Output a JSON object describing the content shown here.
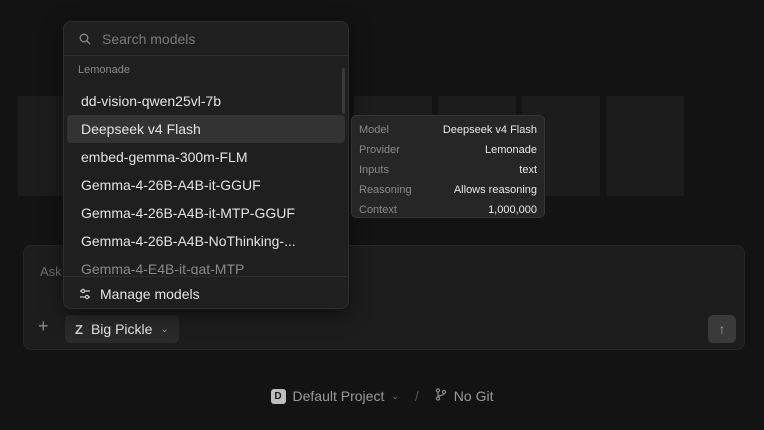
{
  "dropdown": {
    "search_placeholder": "Search models",
    "group_label": "Lemonade",
    "items": [
      {
        "label": "dd-vision-qwen25vl-7b"
      },
      {
        "label": "Deepseek v4 Flash"
      },
      {
        "label": "embed-gemma-300m-FLM"
      },
      {
        "label": "Gemma-4-26B-A4B-it-GGUF"
      },
      {
        "label": "Gemma-4-26B-A4B-it-MTP-GGUF"
      },
      {
        "label": "Gemma-4-26B-A4B-NoThinking-..."
      },
      {
        "label": "Gemma-4-E4B-it-qat-MTP"
      }
    ],
    "active_index": 1,
    "manage_label": "Manage models"
  },
  "tooltip": {
    "rows": [
      {
        "key": "Model",
        "value": "Deepseek v4 Flash"
      },
      {
        "key": "Provider",
        "value": "Lemonade"
      },
      {
        "key": "Inputs",
        "value": "text"
      },
      {
        "key": "Reasoning",
        "value": "Allows reasoning"
      },
      {
        "key": "Context",
        "value": "1,000,000"
      }
    ]
  },
  "composer": {
    "placeholder": "Ask",
    "model_label": "Big Pickle",
    "model_icon": "Z"
  },
  "footer": {
    "project_badge": "D",
    "project_label": "Default Project",
    "separator": "/",
    "git_label": "No Git"
  }
}
